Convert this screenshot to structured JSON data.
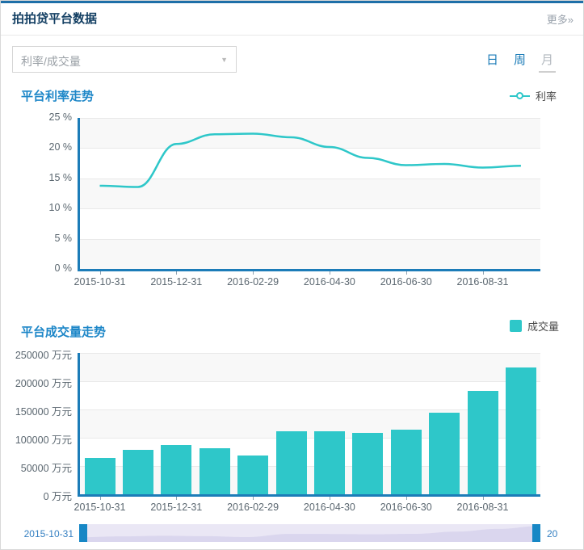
{
  "header": {
    "title": "拍拍贷平台数据",
    "more_label": "更多»"
  },
  "controls": {
    "select_value": "利率/成交量",
    "tabs": [
      {
        "label": "日",
        "active": false
      },
      {
        "label": "周",
        "active": false
      },
      {
        "label": "月",
        "active": true
      }
    ]
  },
  "colors": {
    "series_teal": "#2ec7c9",
    "axis_blue": "#1c7cb8",
    "title_blue": "#1e87c8",
    "header_navy": "#133f63",
    "datazoom_track": "#eae7f5",
    "datazoom_shadow": "#dad6ee",
    "datazoom_handle": "#1787c5"
  },
  "chart_data": [
    {
      "type": "line",
      "title": "平台利率走势",
      "legend": "利率",
      "x": [
        "2015-10-31",
        "2015-11-30",
        "2015-12-31",
        "2016-01-31",
        "2016-02-29",
        "2016-03-31",
        "2016-04-30",
        "2016-05-31",
        "2016-06-30",
        "2016-07-31",
        "2016-08-31",
        "2016-09-30"
      ],
      "x_tick_labels": [
        "2015-10-31",
        "2015-12-31",
        "2016-02-29",
        "2016-04-30",
        "2016-06-30",
        "2016-08-31"
      ],
      "values": [
        13.8,
        13.6,
        20.7,
        22.3,
        22.4,
        21.8,
        20.2,
        18.4,
        17.2,
        17.4,
        16.8,
        17.1
      ],
      "ylim": [
        0,
        25
      ],
      "y_ticks": [
        "0 %",
        "5 %",
        "10 %",
        "15 %",
        "20 %",
        "25 %"
      ],
      "grid": true,
      "legend_position": "top-right"
    },
    {
      "type": "bar",
      "title": "平台成交量走势",
      "legend": "成交量",
      "x": [
        "2015-10-31",
        "2015-11-30",
        "2015-12-31",
        "2016-01-31",
        "2016-02-29",
        "2016-03-31",
        "2016-04-30",
        "2016-05-31",
        "2016-06-30",
        "2016-07-31",
        "2016-08-31",
        "2016-09-30"
      ],
      "x_tick_labels": [
        "2015-10-31",
        "2015-12-31",
        "2016-02-29",
        "2016-04-30",
        "2016-06-30",
        "2016-08-31"
      ],
      "values": [
        65000,
        78000,
        87000,
        81000,
        68000,
        112000,
        111000,
        108000,
        114000,
        145000,
        183000,
        225000
      ],
      "ylim": [
        0,
        250000
      ],
      "y_ticks": [
        "0 万元",
        "50000 万元",
        "100000 万元",
        "150000 万元",
        "200000 万元",
        "250000 万元"
      ],
      "grid": true,
      "legend_position": "top-right"
    }
  ],
  "slider": {
    "start_label": "2015-10-31",
    "end_label": "20"
  }
}
